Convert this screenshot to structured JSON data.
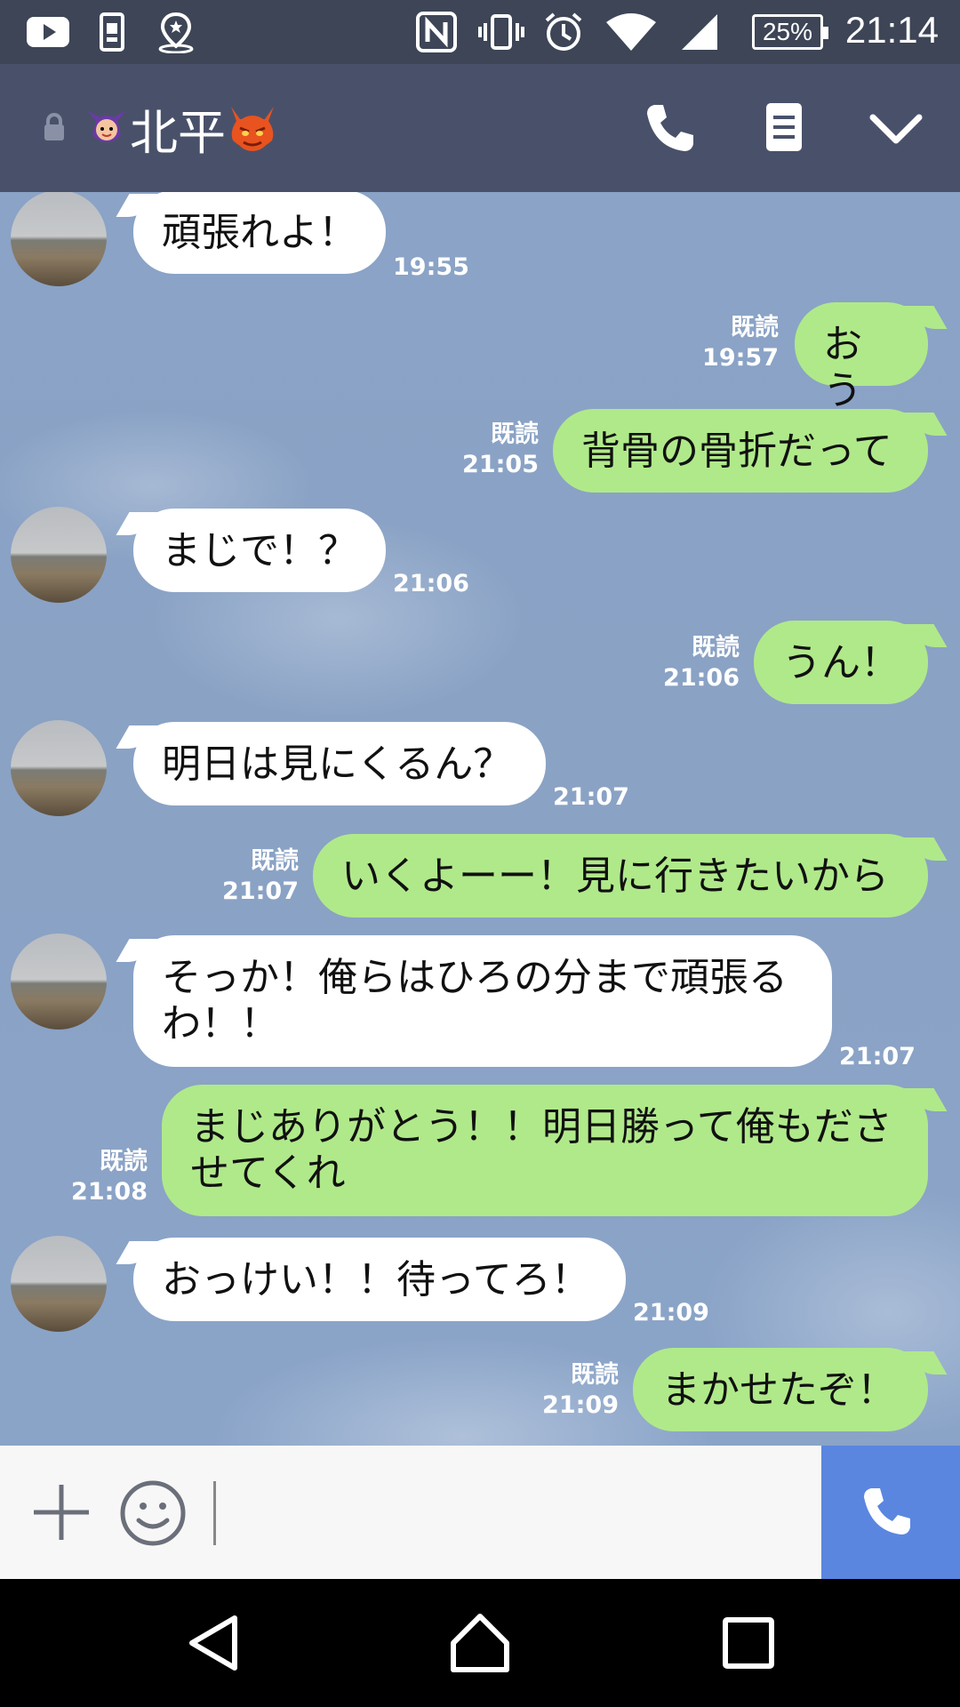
{
  "status_bar": {
    "icons": [
      "youtube-icon",
      "sim-card-icon",
      "location-pin-icon",
      "nfc-icon",
      "vibrate-icon",
      "alarm-icon",
      "wifi-icon",
      "signal-icon"
    ],
    "battery": "25%",
    "time": "21:14"
  },
  "header": {
    "contact_name": "北平",
    "icons": [
      "lock-icon",
      "phone-icon",
      "menu-icon",
      "chevron-down-icon"
    ]
  },
  "messages": [
    {
      "side": "in",
      "text": "頑張れよ！",
      "time": "19:55"
    },
    {
      "side": "out",
      "text": "おう",
      "read": "既読",
      "time": "19:57"
    },
    {
      "side": "out",
      "text": "背骨の骨折だって",
      "read": "既読",
      "time": "21:05"
    },
    {
      "side": "in",
      "text": "まじで！？",
      "time": "21:06"
    },
    {
      "side": "out",
      "text": "うん！",
      "read": "既読",
      "time": "21:06"
    },
    {
      "side": "in",
      "text": "明日は見にくるん？",
      "time": "21:07"
    },
    {
      "side": "out",
      "text": "いくよーー！見に行きたいから",
      "read": "既読",
      "time": "21:07"
    },
    {
      "side": "in",
      "text": "そっか！俺らはひろの分まで頑張るわ！！",
      "time": "21:07"
    },
    {
      "side": "out",
      "text": "まじありがとう！！明日勝って俺もださせてくれ",
      "read": "既読",
      "time": "21:08"
    },
    {
      "side": "in",
      "text": "おっけい！！待ってろ！",
      "time": "21:09"
    },
    {
      "side": "out",
      "text": "まかせたぞ！",
      "read": "既読",
      "time": "21:09"
    }
  ],
  "input": {
    "value": "",
    "icons": [
      "plus-icon",
      "emoji-icon",
      "phone-icon"
    ]
  },
  "colors": {
    "header": "#49516a",
    "status_bar": "#3d4556",
    "outgoing_bubble": "#b0e98a",
    "incoming_bubble": "#ffffff",
    "call_button": "#5b86e0"
  }
}
